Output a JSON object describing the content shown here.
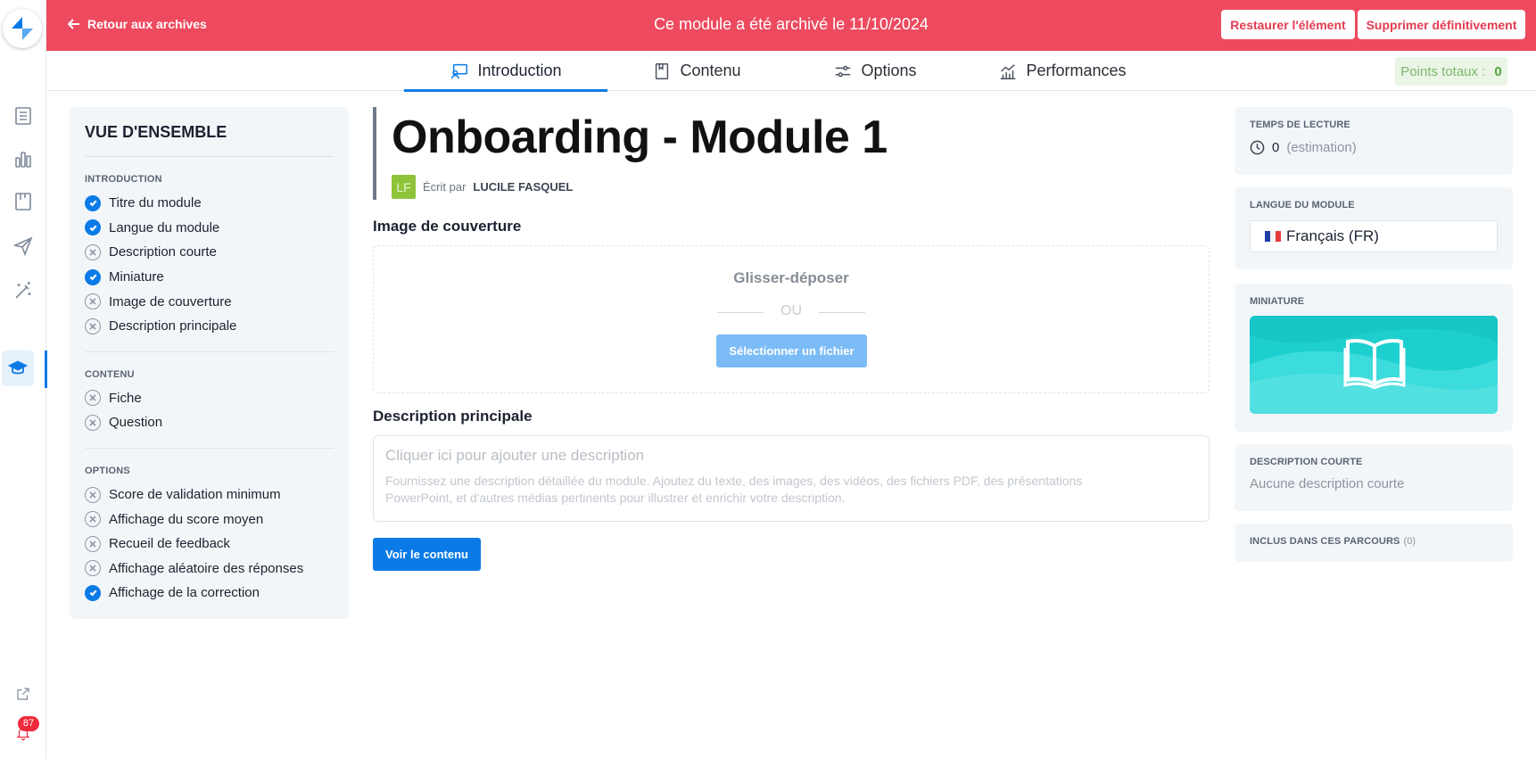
{
  "banner": {
    "back_label": "Retour aux archives",
    "message": "Ce module a été archivé le 11/10/2024",
    "restore_label": "Restaurer l'élément",
    "delete_label": "Supprimer définitivement",
    "color": "#ee4a5f"
  },
  "tabs": [
    {
      "label": "Introduction",
      "icon": "presentation-icon",
      "active": true
    },
    {
      "label": "Contenu",
      "icon": "book-icon",
      "active": false
    },
    {
      "label": "Options",
      "icon": "sliders-icon",
      "active": false
    },
    {
      "label": "Performances",
      "icon": "chart-icon",
      "active": false
    }
  ],
  "points": {
    "label": "Points totaux :",
    "value": "0"
  },
  "overview": {
    "title": "VUE D'ENSEMBLE",
    "sections": [
      {
        "title": "INTRODUCTION",
        "items": [
          {
            "label": "Titre du module",
            "done": true
          },
          {
            "label": "Langue du module",
            "done": true
          },
          {
            "label": "Description courte",
            "done": false
          },
          {
            "label": "Miniature",
            "done": true
          },
          {
            "label": "Image de couverture",
            "done": false
          },
          {
            "label": "Description principale",
            "done": false
          }
        ]
      },
      {
        "title": "CONTENU",
        "items": [
          {
            "label": "Fiche",
            "done": false
          },
          {
            "label": "Question",
            "done": false
          }
        ]
      },
      {
        "title": "OPTIONS",
        "items": [
          {
            "label": "Score de validation minimum",
            "done": false
          },
          {
            "label": "Affichage du score moyen",
            "done": false
          },
          {
            "label": "Recueil de feedback",
            "done": false
          },
          {
            "label": "Affichage aléatoire des réponses",
            "done": false
          },
          {
            "label": "Affichage de la correction",
            "done": true
          }
        ]
      }
    ]
  },
  "module": {
    "title": "Onboarding - Module 1",
    "author_initials": "LF",
    "author_prefix": "Écrit par",
    "author_name": "LUCILE FASQUEL"
  },
  "cover": {
    "label": "Image de couverture",
    "drop_title": "Glisser-déposer",
    "or_text": "OU",
    "select_label": "Sélectionner un fichier"
  },
  "description": {
    "label": "Description principale",
    "placeholder": "Cliquer ici pour ajouter une description",
    "help": "Fournissez une description détaillée du module. Ajoutez du texte, des images, des vidéos, des fichiers PDF, des présentations PowerPoint, et d'autres médias pertinents pour illustrer et enrichir votre description."
  },
  "view_content_label": "Voir le contenu",
  "right": {
    "reading_label": "TEMPS DE LECTURE",
    "reading_value": "0",
    "reading_note": "(estimation)",
    "lang_label": "LANGUE DU MODULE",
    "lang_value": "Français (FR)",
    "thumb_label": "MINIATURE",
    "short_label": "DESCRIPTION COURTE",
    "short_value": "Aucune description courte",
    "paths_label": "INCLUS DANS CES PARCOURS",
    "paths_count": "(0)"
  },
  "rail": {
    "items": [
      "logo-icon",
      "document-icon",
      "bar-chart-icon",
      "board-icon",
      "send-icon",
      "magic-wand-icon",
      "graduation-cap-icon",
      "external-link-icon",
      "bell-icon"
    ],
    "notifications": "87"
  },
  "colors": {
    "accent": "#0a7be6",
    "banner": "#ee4a5f",
    "thumbnail": "#1ecfcf"
  }
}
